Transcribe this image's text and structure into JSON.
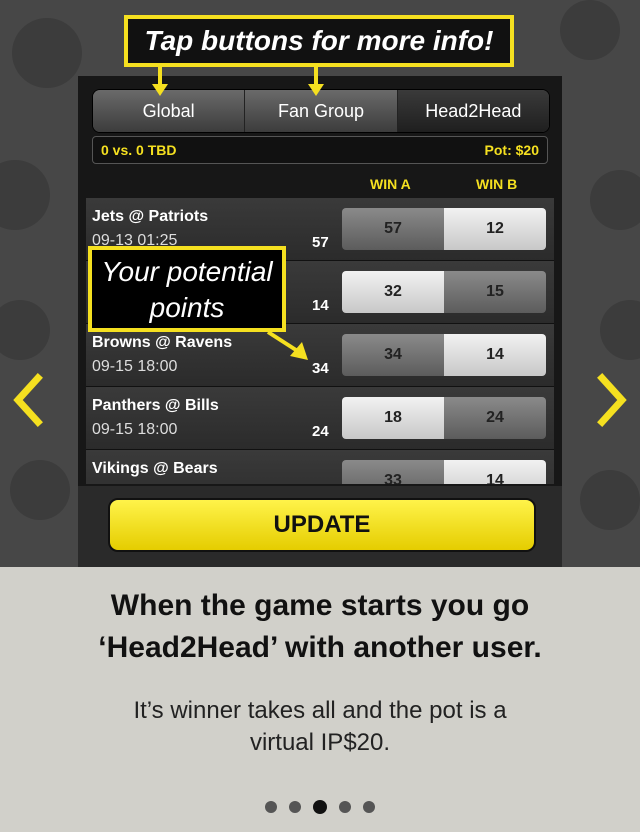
{
  "callouts": {
    "top": "Tap buttons for more info!",
    "points_line1": "Your potential",
    "points_line2": "points"
  },
  "tabs": [
    {
      "label": "Global"
    },
    {
      "label": "Fan Group"
    },
    {
      "label": "Head2Head"
    }
  ],
  "status": {
    "versus": "0 vs. 0 TBD",
    "pot": "Pot: $20"
  },
  "columns": {
    "win_a": "WIN A",
    "win_b": "WIN B"
  },
  "games": [
    {
      "match": "Jets @ Patriots",
      "time": "09-13 01:25",
      "points": "57",
      "win_a": "57",
      "win_b": "12"
    },
    {
      "match": "",
      "time": "",
      "points": "14",
      "win_a": "32",
      "win_b": "15"
    },
    {
      "match": "Browns @ Ravens",
      "time": "09-15 18:00",
      "points": "34",
      "win_a": "34",
      "win_b": "14"
    },
    {
      "match": "Panthers @ Bills",
      "time": "09-15 18:00",
      "points": "24",
      "win_a": "18",
      "win_b": "24"
    },
    {
      "match": "Vikings @ Bears",
      "time": "",
      "points": "",
      "win_a": "33",
      "win_b": "14"
    }
  ],
  "update_label": "UPDATE",
  "bottom": {
    "headline_line1": "When the game starts you go",
    "headline_line2": "‘Head2Head’ with another user.",
    "desc_line1": "It’s winner takes all and the pot is a",
    "desc_line2": "virtual IP$20."
  },
  "pagination": {
    "count": 5,
    "active_index": 2
  },
  "colors": {
    "accent_yellow": "#f5e020",
    "panel_bg": "#171717",
    "bottom_bg": "#d1d0ca"
  }
}
